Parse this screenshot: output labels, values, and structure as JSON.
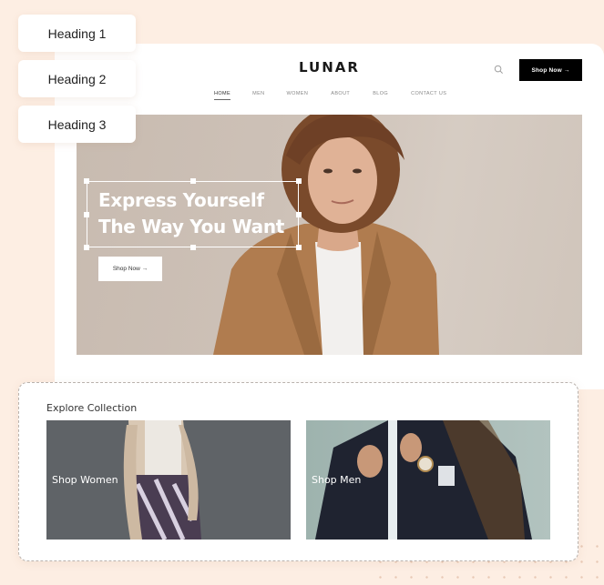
{
  "heading_options": [
    {
      "label": "Heading 1"
    },
    {
      "label": "Heading 2"
    },
    {
      "label": "Heading 3"
    }
  ],
  "site": {
    "logo": "LUNAR",
    "search_icon": "search-icon",
    "header_button": "Shop Now →",
    "nav": [
      {
        "label": "HOME",
        "active": true
      },
      {
        "label": "MEN"
      },
      {
        "label": "WOMEN"
      },
      {
        "label": "ABOUT"
      },
      {
        "label": "BLOG"
      },
      {
        "label": "CONTACT US"
      }
    ],
    "hero": {
      "title_line1": "Express Yourself",
      "title_line2": "The Way You Want",
      "button": "Shop Now →"
    }
  },
  "collection": {
    "title": "Explore Collection",
    "cards": [
      {
        "label": "Shop Women"
      },
      {
        "label": "Shop Men"
      }
    ]
  },
  "colors": {
    "background": "#fdeee3",
    "button_dark": "#000000",
    "accent_text": "#ffffff"
  }
}
